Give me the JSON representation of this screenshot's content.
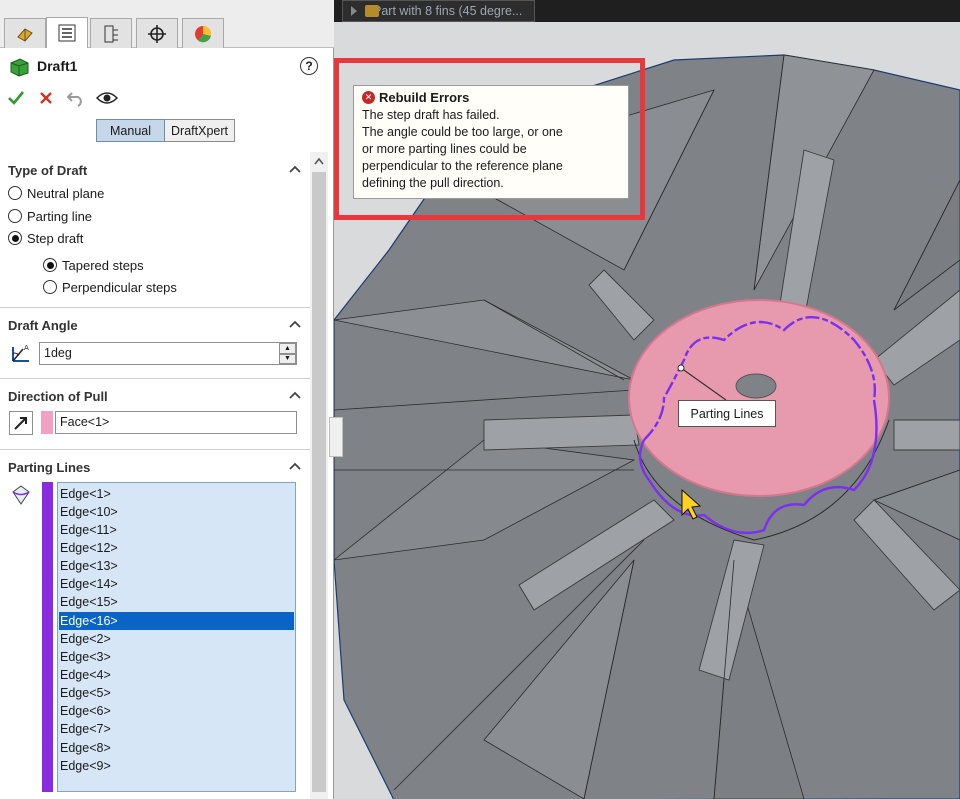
{
  "panel": {
    "feature_title": "Draft1",
    "help": "?",
    "mode_buttons": {
      "manual": "Manual",
      "draftxpert": "DraftXpert"
    },
    "type_of_draft": {
      "label": "Type of Draft",
      "options": [
        "Neutral plane",
        "Parting line",
        "Step draft"
      ],
      "selected": "Step draft",
      "step_options": [
        "Tapered steps",
        "Perpendicular steps"
      ],
      "step_selected": "Tapered steps"
    },
    "draft_angle": {
      "label": "Draft Angle",
      "value": "1deg"
    },
    "direction_of_pull": {
      "label": "Direction of Pull",
      "value": "Face<1>",
      "color": "#f3a0c5"
    },
    "parting_lines": {
      "label": "Parting Lines",
      "color": "#8a2be2",
      "edges": [
        "Edge<1>",
        "Edge<10>",
        "Edge<11>",
        "Edge<12>",
        "Edge<13>",
        "Edge<14>",
        "Edge<15>",
        "Edge<16>",
        "Edge<2>",
        "Edge<3>",
        "Edge<4>",
        "Edge<5>",
        "Edge<6>",
        "Edge<7>",
        "Edge<8>",
        "Edge<9>"
      ],
      "selected": "Edge<16>"
    }
  },
  "viewport": {
    "breadcrumb": "Part with 8 fins (45 degre...",
    "error": {
      "title": "Rebuild Errors",
      "lines": [
        "The step draft has failed.",
        "The angle could be too large, or one",
        "or more parting lines could be",
        "perpendicular to the reference plane",
        "defining the pull direction."
      ],
      "frame_color": "#e8383d"
    },
    "callout": "Parting Lines",
    "colors": {
      "model": "#7b7f84",
      "face": "#e79aae",
      "parting_line": "#7b2ff0"
    }
  }
}
